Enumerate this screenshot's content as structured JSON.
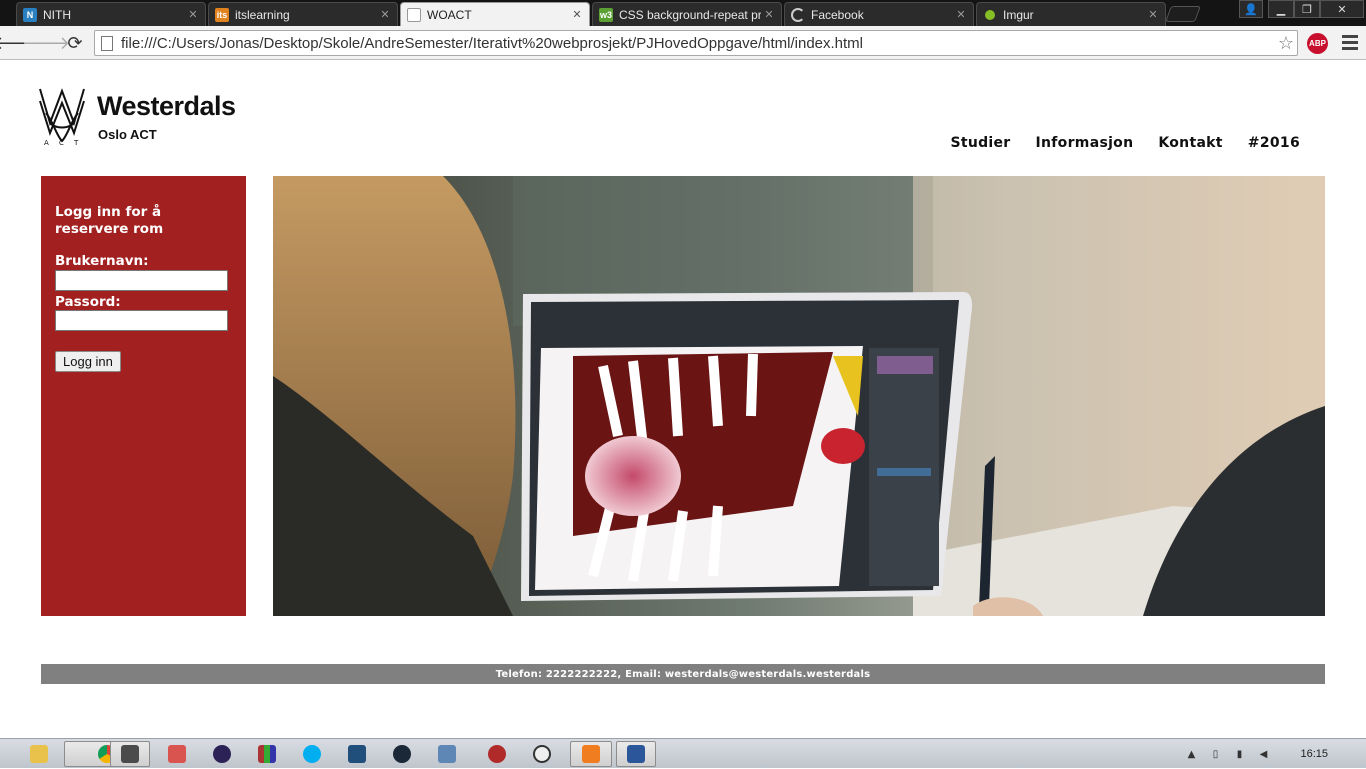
{
  "browser": {
    "tabs": [
      {
        "title": "NITH",
        "favicon": "nith-icon",
        "color": "#2a7fc0",
        "glyph": "N"
      },
      {
        "title": "itslearning",
        "favicon": "itslearning-icon",
        "color": "#e0821e",
        "glyph": "its"
      },
      {
        "title": "WOACT",
        "favicon": "page-icon",
        "color": "#ffffff",
        "glyph": ""
      },
      {
        "title": "CSS background-repeat pr",
        "favicon": "w3schools-icon",
        "color": "#5aa033",
        "glyph": "w3"
      },
      {
        "title": "Facebook",
        "favicon": "loading-icon",
        "color": "#2b2b2b",
        "glyph": ""
      },
      {
        "title": "Imgur",
        "favicon": "imgur-icon",
        "color": "#85bf25",
        "glyph": ""
      }
    ],
    "url": "file:///C:/Users/Jonas/Desktop/Skole/AndreSemester/Iterativt%20webprosjekt/PJHovedOppgave/html/index.html",
    "extension_label": "ABP"
  },
  "site": {
    "logo": {
      "name": "Westerdals",
      "sub": "Oslo ACT"
    },
    "nav": [
      "Studier",
      "Informasjon",
      "Kontakt",
      "#2016"
    ],
    "login": {
      "heading": "Logg inn for å reservere rom",
      "username_label": "Brukernavn:",
      "password_label": "Passord:",
      "button": "Logg inn"
    },
    "hero_image": "student-drawing-on-laptop-photo",
    "footer": "Telefon: 2222222222, Email: westerdals@westerdals.westerdals"
  },
  "taskbar": {
    "apps": [
      "explorer-icon",
      "chrome-icon",
      "app-icon",
      "popcorn-icon",
      "eclipse-icon",
      "winrar-icon",
      "skype-icon",
      "sketchup-icon",
      "steam-icon",
      "notepad-icon",
      "git-icon",
      "unity-icon",
      "xampp-icon",
      "word-icon"
    ],
    "clock": "16:15"
  },
  "colors": {
    "login_bg": "#a32020",
    "footer_bg": "#808080"
  }
}
